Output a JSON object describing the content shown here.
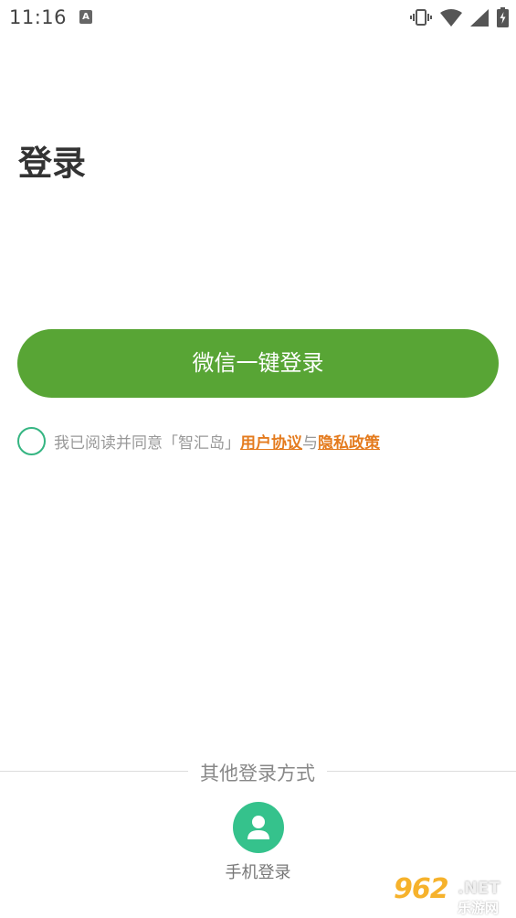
{
  "status_bar": {
    "time": "11:16",
    "notification_badge": "A",
    "icons": [
      "vibrate-icon",
      "wifi-icon",
      "signal-icon",
      "battery-icon"
    ]
  },
  "page": {
    "title": "登录"
  },
  "wechat_login": {
    "label": "微信一键登录",
    "color": "#58a535"
  },
  "agreement": {
    "prefix": "我已阅读并同意「智汇岛」",
    "user_agreement": "用户协议",
    "separator": "与",
    "privacy_policy": "隐私政策",
    "checked": false,
    "link_color": "#e47b1e"
  },
  "other_login": {
    "label": "其他登录方式",
    "methods": [
      {
        "label": "手机登录",
        "icon": "user-icon",
        "color": "#35c28c"
      }
    ]
  },
  "watermark": {
    "main": "962",
    "suffix": ".NET",
    "sub": "乐游网"
  }
}
